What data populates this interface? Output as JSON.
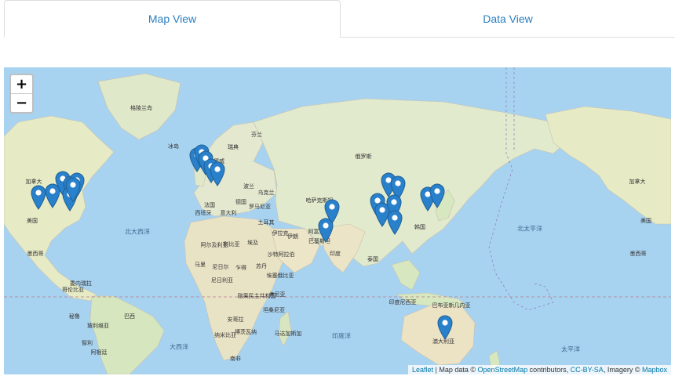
{
  "tabs": [
    {
      "label": "Map View",
      "active": true
    },
    {
      "label": "Data View",
      "active": false
    }
  ],
  "map": {
    "zoom_in_label": "+",
    "zoom_out_label": "−",
    "marker_color": "#2a81cb",
    "marker_count": 24,
    "labels": [
      {
        "text": "格陵兰岛",
        "kind": "country"
      },
      {
        "text": "冰岛",
        "kind": "country"
      },
      {
        "text": "芬兰",
        "kind": "country"
      },
      {
        "text": "瑞典",
        "kind": "country"
      },
      {
        "text": "挪威",
        "kind": "country"
      },
      {
        "text": "加拿大",
        "kind": "country"
      },
      {
        "text": "加拿大",
        "kind": "country"
      },
      {
        "text": "美国",
        "kind": "country"
      },
      {
        "text": "美国",
        "kind": "country"
      },
      {
        "text": "墨西哥",
        "kind": "country"
      },
      {
        "text": "墨西哥",
        "kind": "country"
      },
      {
        "text": "北大西洋",
        "kind": "ocean"
      },
      {
        "text": "北太平洋",
        "kind": "ocean"
      },
      {
        "text": "俄罗斯",
        "kind": "country"
      },
      {
        "text": "哈萨克斯坦",
        "kind": "country"
      },
      {
        "text": "蒙古",
        "kind": "country"
      },
      {
        "text": "韩国",
        "kind": "country"
      },
      {
        "text": "德国",
        "kind": "country"
      },
      {
        "text": "法国",
        "kind": "country"
      },
      {
        "text": "西班牙",
        "kind": "country"
      },
      {
        "text": "意大利",
        "kind": "country"
      },
      {
        "text": "乌克兰",
        "kind": "country"
      },
      {
        "text": "波兰",
        "kind": "country"
      },
      {
        "text": "罗马尼亚",
        "kind": "country"
      },
      {
        "text": "土耳其",
        "kind": "country"
      },
      {
        "text": "伊拉克",
        "kind": "country"
      },
      {
        "text": "伊朗",
        "kind": "country"
      },
      {
        "text": "阿富汗",
        "kind": "country"
      },
      {
        "text": "巴基斯坦",
        "kind": "country"
      },
      {
        "text": "印度",
        "kind": "country"
      },
      {
        "text": "泰国",
        "kind": "country"
      },
      {
        "text": "埃及",
        "kind": "country"
      },
      {
        "text": "利比亚",
        "kind": "country"
      },
      {
        "text": "阿尔及利亚",
        "kind": "country"
      },
      {
        "text": "沙特阿拉伯",
        "kind": "country"
      },
      {
        "text": "马里",
        "kind": "country"
      },
      {
        "text": "尼日尔",
        "kind": "country"
      },
      {
        "text": "尼日利亚",
        "kind": "country"
      },
      {
        "text": "乍得",
        "kind": "country"
      },
      {
        "text": "苏丹",
        "kind": "country"
      },
      {
        "text": "埃塞俄比亚",
        "kind": "country"
      },
      {
        "text": "肯尼亚",
        "kind": "country"
      },
      {
        "text": "坦桑尼亚",
        "kind": "country"
      },
      {
        "text": "刚果民主共和国",
        "kind": "country"
      },
      {
        "text": "安哥拉",
        "kind": "country"
      },
      {
        "text": "纳米比亚",
        "kind": "country"
      },
      {
        "text": "博茨瓦纳",
        "kind": "country"
      },
      {
        "text": "南非",
        "kind": "country"
      },
      {
        "text": "马达加斯加",
        "kind": "country"
      },
      {
        "text": "委内瑞拉",
        "kind": "country"
      },
      {
        "text": "哥伦比亚",
        "kind": "country"
      },
      {
        "text": "秘鲁",
        "kind": "country"
      },
      {
        "text": "巴西",
        "kind": "country"
      },
      {
        "text": "玻利维亚",
        "kind": "country"
      },
      {
        "text": "智利",
        "kind": "country"
      },
      {
        "text": "阿根廷",
        "kind": "country"
      },
      {
        "text": "印度尼西亚",
        "kind": "country"
      },
      {
        "text": "巴布亚新几内亚",
        "kind": "country"
      },
      {
        "text": "澳大利亚",
        "kind": "country"
      },
      {
        "text": "大西洋",
        "kind": "ocean"
      },
      {
        "text": "印度洋",
        "kind": "ocean"
      },
      {
        "text": "太平洋",
        "kind": "ocean"
      }
    ]
  },
  "attribution": {
    "leaflet": "Leaflet",
    "sep1": " | Map data © ",
    "osm": "OpenStreetMap",
    "sep2": " contributors, ",
    "license": "CC-BY-SA",
    "sep3": ", Imagery © ",
    "mapbox": "Mapbox"
  }
}
